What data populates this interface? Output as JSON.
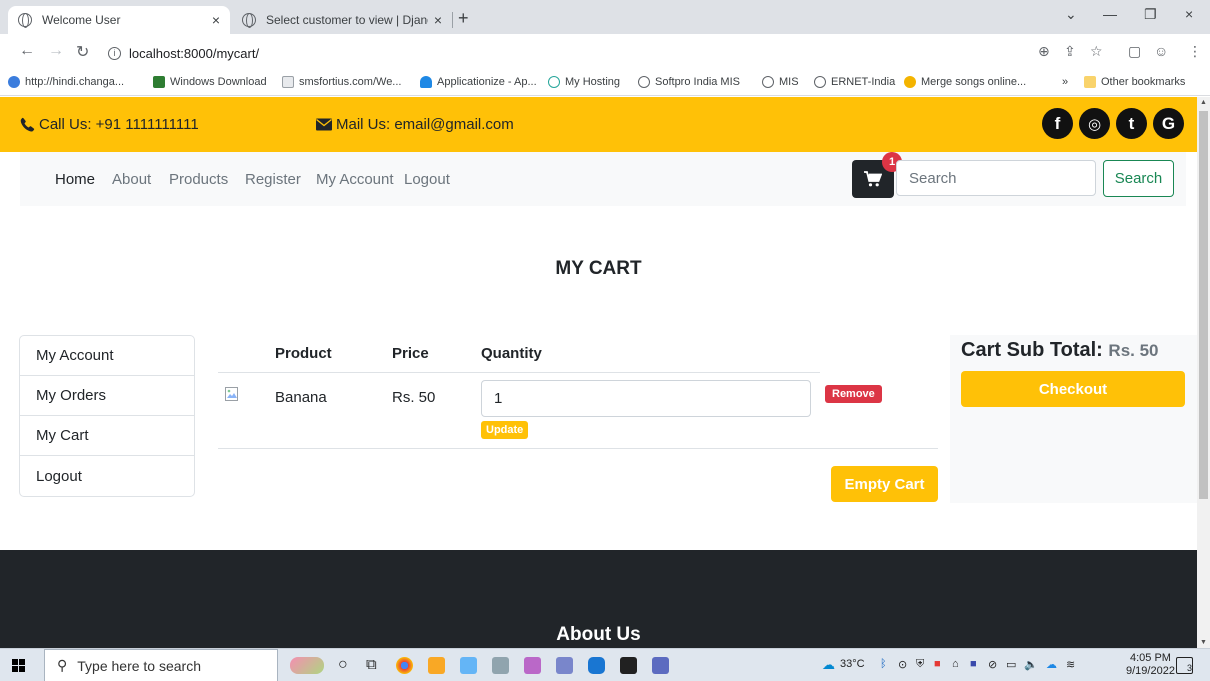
{
  "browser": {
    "tabs": [
      {
        "title": "Welcome User",
        "active": true
      },
      {
        "title": "Select customer to view | Django",
        "active": false
      }
    ],
    "new_tab": "+",
    "close_glyph": "×",
    "url": "localhost:8000/mycart/",
    "bookmarks": [
      {
        "label": "http://hindi.changa...",
        "color": "#3b7ddd"
      },
      {
        "label": "Windows Download",
        "color": "#2e7d32"
      },
      {
        "label": "smsfortius.com/We...",
        "color": "#9aa0a6"
      },
      {
        "label": "Applicationize - Ap...",
        "color": "#1e88e5"
      },
      {
        "label": "My Hosting",
        "color": "#26a69a"
      },
      {
        "label": "Softpro India MIS",
        "color": "#5f6368"
      },
      {
        "label": "MIS",
        "color": "#5f6368"
      },
      {
        "label": "ERNET-India",
        "color": "#5f6368"
      },
      {
        "label": "Merge songs online...",
        "color": "#f4b400"
      }
    ],
    "bookmarks_more": "»",
    "other_bookmarks": "Other bookmarks"
  },
  "topbar": {
    "call": "Call Us: +91 1111111111",
    "mail": "Mail Us: email@gmail.com",
    "social": [
      "f",
      "◎",
      "t",
      "G"
    ]
  },
  "nav": {
    "links": [
      "Home",
      "About",
      "Products",
      "Register",
      "My Account",
      "Logout"
    ],
    "cart_count": "1",
    "search_placeholder": "Search",
    "search_button": "Search"
  },
  "page": {
    "title": "MY CART"
  },
  "sidemenu": [
    "My Account",
    "My Orders",
    "My Cart",
    "Logout"
  ],
  "cart": {
    "headers": {
      "product": "Product",
      "price": "Price",
      "quantity": "Quantity"
    },
    "items": [
      {
        "product": "Banana",
        "price": "Rs. 50",
        "quantity": "1"
      }
    ],
    "update_label": "Update",
    "remove_label": "Remove",
    "empty_label": "Empty Cart"
  },
  "summary": {
    "label": "Cart Sub Total:",
    "amount": "Rs. 50",
    "checkout_label": "Checkout"
  },
  "footer": {
    "heading": "About Us"
  },
  "taskbar": {
    "search_placeholder": "Type here to search",
    "temperature": "33°C",
    "time": "4:05 PM",
    "date": "9/19/2022",
    "notification_count": "3"
  },
  "colors": {
    "brand": "#ffc107",
    "dark": "#212529",
    "danger": "#dc3545",
    "success": "#198754"
  }
}
